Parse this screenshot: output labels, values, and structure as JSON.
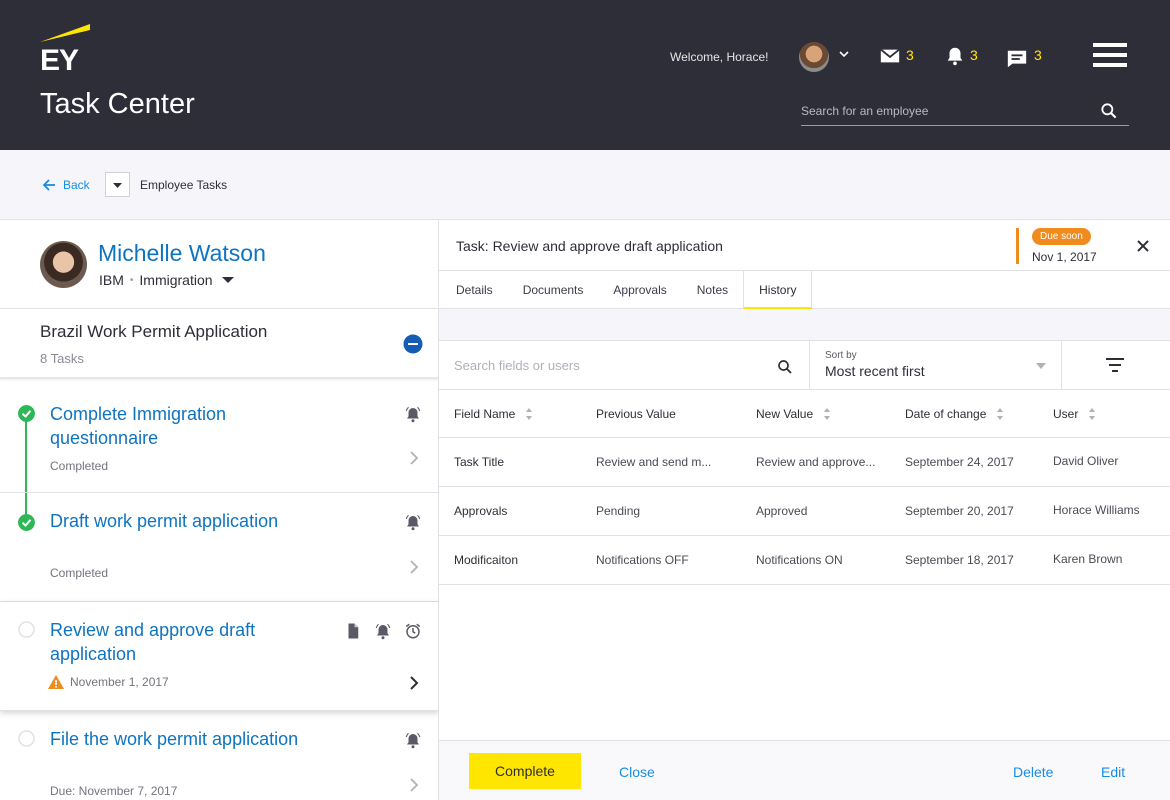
{
  "header": {
    "logo_text": "EY",
    "app_title": "Task Center",
    "welcome": "Welcome, Horace!",
    "mail_count": "3",
    "notification_count": "3",
    "message_count": "3",
    "search_placeholder": "Search for an employee",
    "colors": {
      "bg": "#2e2e38",
      "accent": "#ffe600"
    }
  },
  "subnav": {
    "back_label": "Back",
    "breadcrumb": "Employee Tasks"
  },
  "employee": {
    "name": "Michelle Watson",
    "company": "IBM",
    "category": "Immigration"
  },
  "project": {
    "title": "Brazil Work Permit Application",
    "count": "8 Tasks"
  },
  "tasks": [
    {
      "title": "Complete Immigration questionnaire",
      "meta": "Completed",
      "status": "complete"
    },
    {
      "title": "Draft work permit application",
      "meta": "Completed",
      "status": "complete"
    },
    {
      "title": "Review and approve draft application",
      "meta": "November 1, 2017",
      "status": "pending",
      "warning": true
    },
    {
      "title": "File the work permit application",
      "meta": "Due: November 7, 2017",
      "status": "pending"
    }
  ],
  "detail": {
    "task_title": "Task: Review and approve draft application",
    "due_badge": "Due soon",
    "due_date": "Nov 1, 2017",
    "due_color": "#f08b1d",
    "tabs": [
      "Details",
      "Documents",
      "Approvals",
      "Notes",
      "History"
    ],
    "selected_tab": "History",
    "search_placeholder": "Search fields or users",
    "sort_label": "Sort by",
    "sort_value": "Most recent first",
    "columns": [
      "Field Name",
      "Previous Value",
      "New Value",
      "Date of change",
      "User"
    ],
    "rows": [
      [
        "Task Title",
        "Review and send m...",
        "Review and approve...",
        "September 24, 2017",
        "David Oliver"
      ],
      [
        "Approvals",
        "Pending",
        "Approved",
        "September 20, 2017",
        "Horace Williams"
      ],
      [
        "Modificaiton",
        "Notifications OFF",
        "Notifications ON",
        "September 18, 2017",
        "Karen Brown"
      ]
    ],
    "actions": {
      "complete": "Complete",
      "close": "Close",
      "delete": "Delete",
      "edit": "Edit"
    }
  }
}
